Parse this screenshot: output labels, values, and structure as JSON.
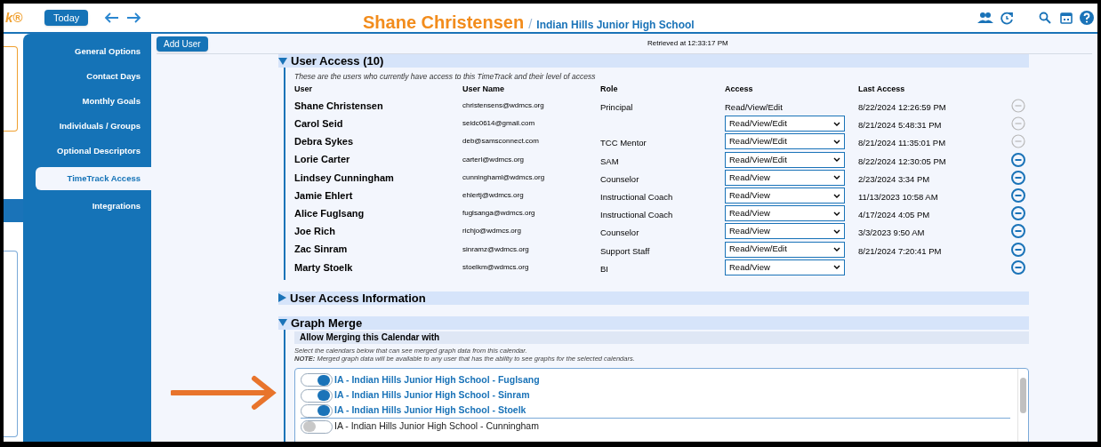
{
  "topbar": {
    "logo": "k®",
    "today_button": "Today",
    "user": "Shane Christensen",
    "separator": "/",
    "school": "Indian Hills Junior High School"
  },
  "sidebar": {
    "items": [
      {
        "label": "General Options",
        "selected": false
      },
      {
        "label": "Contact Days",
        "selected": false
      },
      {
        "label": "Monthly Goals",
        "selected": false
      },
      {
        "label": "Individuals / Groups",
        "selected": false
      },
      {
        "label": "Optional Descriptors",
        "selected": false
      },
      {
        "label": "TimeTrack Access",
        "selected": true
      },
      {
        "label": "Integrations",
        "selected": false
      }
    ]
  },
  "toolbar": {
    "add_button": "Add User",
    "retrieved": "Retrieved at 12:33:17 PM"
  },
  "user_access": {
    "title": "User Access (10)",
    "expanded": true,
    "description": "These are the users who currently have access to this TimeTrack and their level of access",
    "columns": [
      "User",
      "User Name",
      "Role",
      "Access",
      "Last Access"
    ],
    "rows": [
      {
        "name": "Shane Christensen",
        "username": "christensens@wdmcs.org",
        "role": "Principal",
        "access": {
          "kind": "text",
          "value": "Read/View/Edit"
        },
        "last_access": "8/22/2024 12:26:59 PM",
        "removable": false
      },
      {
        "name": "Carol Seid",
        "username": "seidc0614@gmail.com",
        "access": {
          "kind": "select",
          "value": "Read/View/Edit"
        },
        "last_access": "8/21/2024 5:48:31 PM",
        "removable": false
      },
      {
        "name": "Debra Sykes",
        "username": "deb@samsconnect.com",
        "role": "TCC Mentor",
        "access": {
          "kind": "select",
          "value": "Read/View/Edit"
        },
        "last_access": "8/21/2024 11:35:01 PM",
        "removable": false
      },
      {
        "name": "Lorie Carter",
        "username": "carterl@wdmcs.org",
        "role": "SAM",
        "access": {
          "kind": "select",
          "value": "Read/View/Edit"
        },
        "last_access": "8/22/2024 12:30:05 PM",
        "removable": true
      },
      {
        "name": "Lindsey Cunningham",
        "username": "cunninghaml@wdmcs.org",
        "role": "Counselor",
        "access": {
          "kind": "select",
          "value": "Read/View"
        },
        "last_access": "2/23/2024 3:34 PM",
        "removable": true
      },
      {
        "name": "Jamie Ehlert",
        "username": "ehlertj@wdmcs.org",
        "role": "Instructional Coach",
        "access": {
          "kind": "select",
          "value": "Read/View"
        },
        "last_access": "11/13/2023 10:58 AM",
        "removable": true
      },
      {
        "name": "Alice Fuglsang",
        "username": "fuglsanga@wdmcs.org",
        "role": "Instructional Coach",
        "access": {
          "kind": "select",
          "value": "Read/View"
        },
        "last_access": "4/17/2024 4:05 PM",
        "removable": true
      },
      {
        "name": "Joe Rich",
        "username": "richjo@wdmcs.org",
        "role": "Counselor",
        "access": {
          "kind": "select",
          "value": "Read/View"
        },
        "last_access": "3/3/2023 9:50 AM",
        "removable": true
      },
      {
        "name": "Zac Sinram",
        "username": "sinramz@wdmcs.org",
        "role": "Support Staff",
        "access": {
          "kind": "select",
          "value": "Read/View/Edit"
        },
        "last_access": "8/21/2024 7:20:41 PM",
        "removable": true
      },
      {
        "name": "Marty Stoelk",
        "username": "stoelkm@wdmcs.org",
        "role": "BI",
        "access": {
          "kind": "select",
          "value": "Read/View"
        },
        "removable": true
      }
    ]
  },
  "user_access_information": {
    "title": "User Access Information",
    "expanded": false
  },
  "graph_merge": {
    "title": "Graph Merge",
    "expanded": true,
    "subheader": "Allow Merging this Calendar with",
    "notes": [
      "Select the calendars below that can see merged graph data from this calendar.",
      "**NOTE:** Merged graph data will be available to any user that has the ability to see graphs for the selected calendars."
    ],
    "calendars": [
      {
        "label": "IA - Indian Hills Junior High School - Fuglsang",
        "on": true
      },
      {
        "label": "IA - Indian Hills Junior High School - Sinram",
        "on": true
      },
      {
        "label": "IA - Indian Hills Junior High School - Stoelk",
        "on": true
      },
      {
        "label": "IA - Indian Hills Junior High School - Cunningham",
        "on": false
      }
    ]
  }
}
